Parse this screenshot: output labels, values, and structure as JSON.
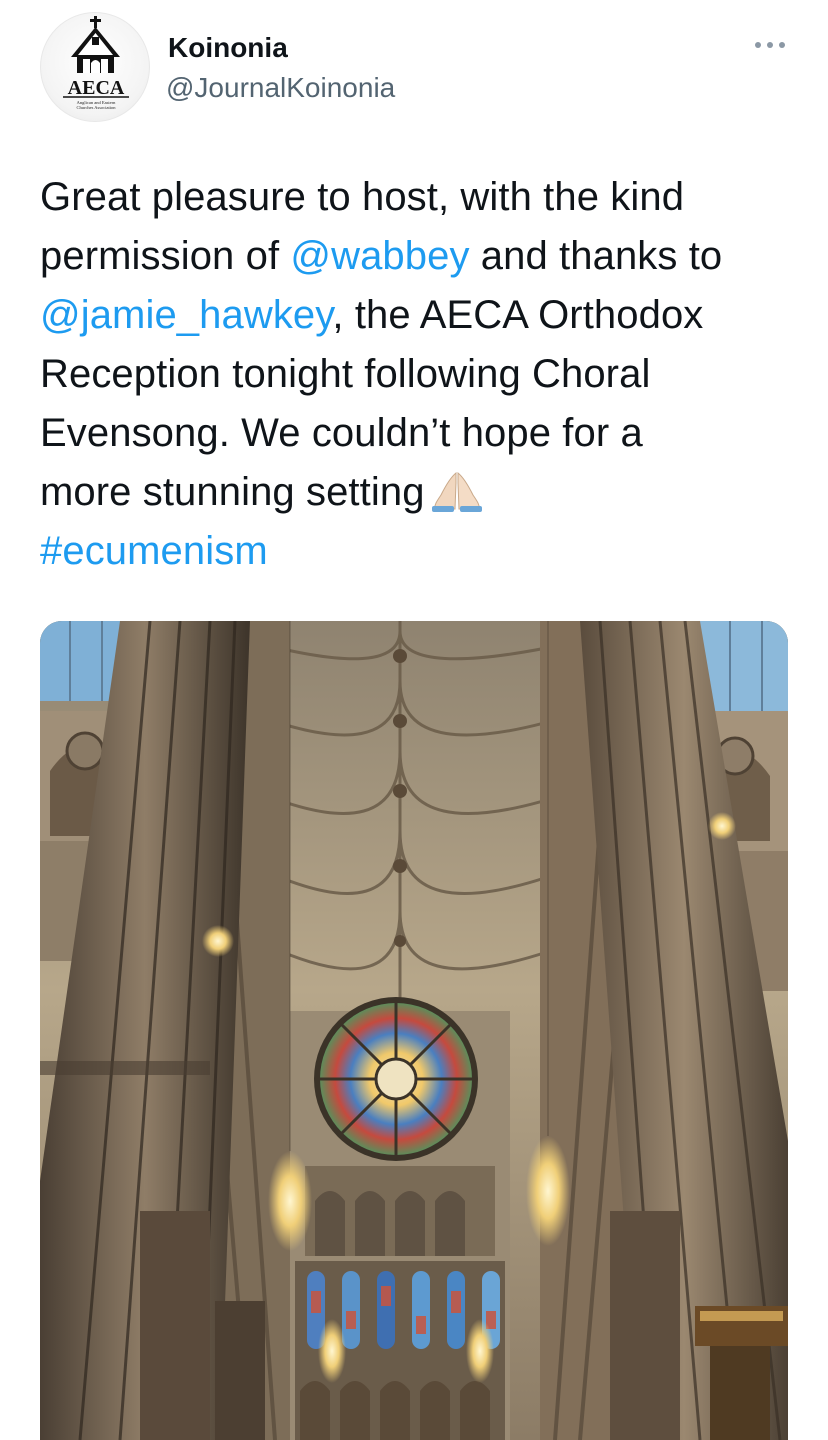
{
  "author": {
    "display_name": "Koinonia",
    "handle": "@JournalKoinonia",
    "avatar": {
      "logo_text": "AECA",
      "logo_subtext": "Anglican and Eastern Churches Association"
    }
  },
  "more_icon": "more-horizontal-icon",
  "tweet": {
    "line1": "Great pleasure to host, with the kind",
    "line2_a": "permission of ",
    "mention1": "@wabbey",
    "line2_b": " and thanks to",
    "mention2": "@jamie_hawkey",
    "line3_b": ", the AECA Orthodox",
    "line4": "Reception tonight following Choral",
    "line5": "Evensong. We couldn’t hope for a",
    "line6": "more stunning setting",
    "emoji": "folded-hands-emoji",
    "hashtag": "#ecumenism"
  },
  "media": {
    "kind": "photo",
    "subject": "cathedral-nave-interior"
  },
  "colors": {
    "link": "#1d9bf0",
    "text": "#0f1419",
    "secondary": "#536471"
  }
}
